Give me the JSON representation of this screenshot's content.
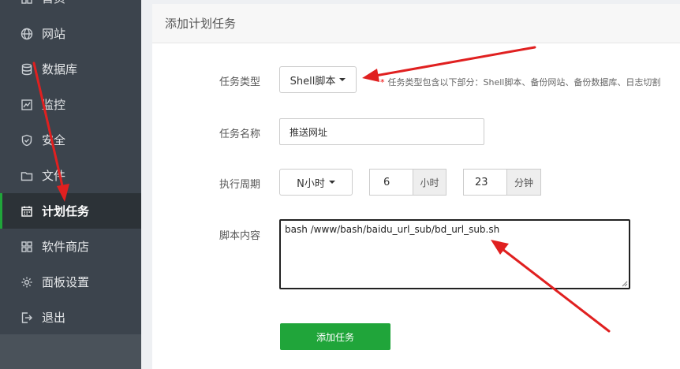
{
  "sidebar": {
    "items": [
      {
        "label": "首页",
        "icon": "home-icon"
      },
      {
        "label": "网站",
        "icon": "globe-icon"
      },
      {
        "label": "数据库",
        "icon": "database-icon"
      },
      {
        "label": "监控",
        "icon": "monitor-icon"
      },
      {
        "label": "安全",
        "icon": "shield-icon"
      },
      {
        "label": "文件",
        "icon": "folder-icon"
      },
      {
        "label": "计划任务",
        "icon": "calendar-icon",
        "active": true
      },
      {
        "label": "软件商店",
        "icon": "apps-grid-icon"
      },
      {
        "label": "面板设置",
        "icon": "gear-icon"
      },
      {
        "label": "退出",
        "icon": "logout-icon"
      }
    ]
  },
  "panel": {
    "title": "添加计划任务",
    "task_type": {
      "label": "任务类型",
      "value": "Shell脚本",
      "hint_star": "*",
      "hint": "任务类型包含以下部分：Shell脚本、备份网站、备份数据库、日志切割"
    },
    "task_name": {
      "label": "任务名称",
      "value": "推送网址"
    },
    "period": {
      "label": "执行周期",
      "type_value": "N小时",
      "hour_value": "6",
      "hour_unit": "小时",
      "minute_value": "23",
      "minute_unit": "分钟"
    },
    "script": {
      "label": "脚本内容",
      "value": "bash /www/bash/baidu_url_sub/bd_url_sub.sh"
    },
    "submit_label": "添加任务"
  },
  "colors": {
    "sidebar_bg": "#3c444d",
    "accent_green": "#20a53a",
    "annotation_red": "#e02020"
  }
}
